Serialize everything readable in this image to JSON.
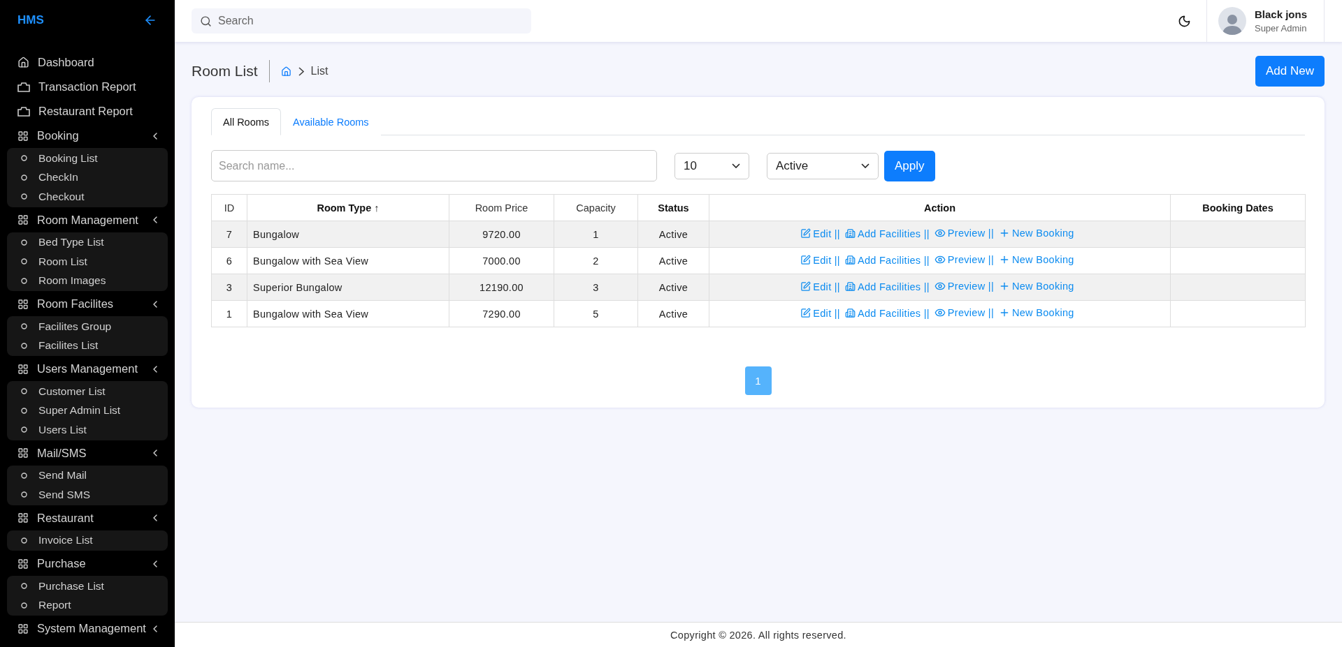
{
  "sidebar": {
    "brand": "HMS",
    "items": [
      {
        "kind": "home",
        "label": "Dashboard"
      },
      {
        "kind": "report",
        "label": "Transaction Report"
      },
      {
        "kind": "report",
        "label": "Restaurant Report"
      },
      {
        "kind": "group",
        "label": "Booking",
        "expanded": true,
        "children": [
          {
            "label": "Booking List"
          },
          {
            "label": "CheckIn"
          },
          {
            "label": "Checkout"
          }
        ]
      },
      {
        "kind": "group",
        "label": "Room Management",
        "expanded": true,
        "children": [
          {
            "label": "Bed Type List"
          },
          {
            "label": "Room List"
          },
          {
            "label": "Room Images"
          }
        ]
      },
      {
        "kind": "group",
        "label": "Room Facilites",
        "expanded": true,
        "children": [
          {
            "label": "Facilites Group"
          },
          {
            "label": "Facilites List"
          }
        ]
      },
      {
        "kind": "group",
        "label": "Users Management",
        "expanded": true,
        "children": [
          {
            "label": "Customer List"
          },
          {
            "label": "Super Admin List"
          },
          {
            "label": "Users List"
          }
        ]
      },
      {
        "kind": "group",
        "label": "Mail/SMS",
        "expanded": true,
        "children": [
          {
            "label": "Send Mail"
          },
          {
            "label": "Send SMS"
          }
        ]
      },
      {
        "kind": "group",
        "label": "Restaurant",
        "expanded": true,
        "children": [
          {
            "label": "Invoice List"
          }
        ]
      },
      {
        "kind": "group",
        "label": "Purchase",
        "expanded": true,
        "children": [
          {
            "label": "Purchase List"
          },
          {
            "label": "Report"
          }
        ]
      },
      {
        "kind": "group",
        "label": "System Management"
      }
    ]
  },
  "topbar": {
    "search": {
      "placeholder": "Search"
    },
    "user": {
      "name": "Black jons",
      "role": "Super Admin"
    }
  },
  "page": {
    "title": "Room List",
    "breadcrumb": "List",
    "add_button": "Add New"
  },
  "tabs": [
    {
      "label": "All Rooms",
      "selected": true
    },
    {
      "label": "Available Rooms",
      "selected": false
    }
  ],
  "filters": {
    "search": {
      "placeholder": "Search name..."
    },
    "page_size": "10",
    "status": "Active",
    "apply": "Apply"
  },
  "table": {
    "columns": [
      {
        "label": "ID",
        "bold": false
      },
      {
        "label": "Room Type ↑",
        "bold": true
      },
      {
        "label": "Room Price",
        "bold": false
      },
      {
        "label": "Capacity",
        "bold": false
      },
      {
        "label": "Status",
        "bold": true
      },
      {
        "label": "Action",
        "bold": true
      },
      {
        "label": "Booking Dates",
        "bold": true
      }
    ],
    "rows": [
      {
        "id": "7",
        "room_type": "Bungalow",
        "price": "9720.00",
        "capacity": "1",
        "status": "Active",
        "actions": [
          {
            "kind": "edit",
            "label": "Edit",
            "separator": "||"
          },
          {
            "kind": "facilities",
            "label": "Add Facilities",
            "separator": "||"
          },
          {
            "kind": "preview",
            "label": "Preview",
            "separator": "||"
          },
          {
            "kind": "booking",
            "label": "New Booking"
          }
        ]
      },
      {
        "id": "6",
        "room_type": "Bungalow with Sea View",
        "price": "7000.00",
        "capacity": "2",
        "status": "Active",
        "actions": [
          {
            "kind": "edit",
            "label": "Edit",
            "separator": "||"
          },
          {
            "kind": "facilities",
            "label": "Add Facilities",
            "separator": "||"
          },
          {
            "kind": "preview",
            "label": "Preview",
            "separator": "||"
          },
          {
            "kind": "booking",
            "label": "New Booking"
          }
        ]
      },
      {
        "id": "3",
        "room_type": "Superior Bungalow",
        "price": "12190.00",
        "capacity": "3",
        "status": "Active",
        "actions": [
          {
            "kind": "edit",
            "label": "Edit",
            "separator": "||"
          },
          {
            "kind": "facilities",
            "label": "Add Facilities",
            "separator": "||"
          },
          {
            "kind": "preview",
            "label": "Preview",
            "separator": "||"
          },
          {
            "kind": "booking",
            "label": "New Booking"
          }
        ]
      },
      {
        "id": "1",
        "room_type": "Bungalow with Sea View",
        "price": "7290.00",
        "capacity": "5",
        "status": "Active",
        "actions": [
          {
            "kind": "edit",
            "label": "Edit",
            "separator": "||"
          },
          {
            "kind": "facilities",
            "label": "Add Facilities",
            "separator": "||"
          },
          {
            "kind": "preview",
            "label": "Preview",
            "separator": "||"
          },
          {
            "kind": "booking",
            "label": "New Booking"
          }
        ]
      }
    ]
  },
  "pagination": [
    {
      "label": "1",
      "selected": true
    }
  ],
  "footer": "Copyright © 2026. All rights reserved."
}
